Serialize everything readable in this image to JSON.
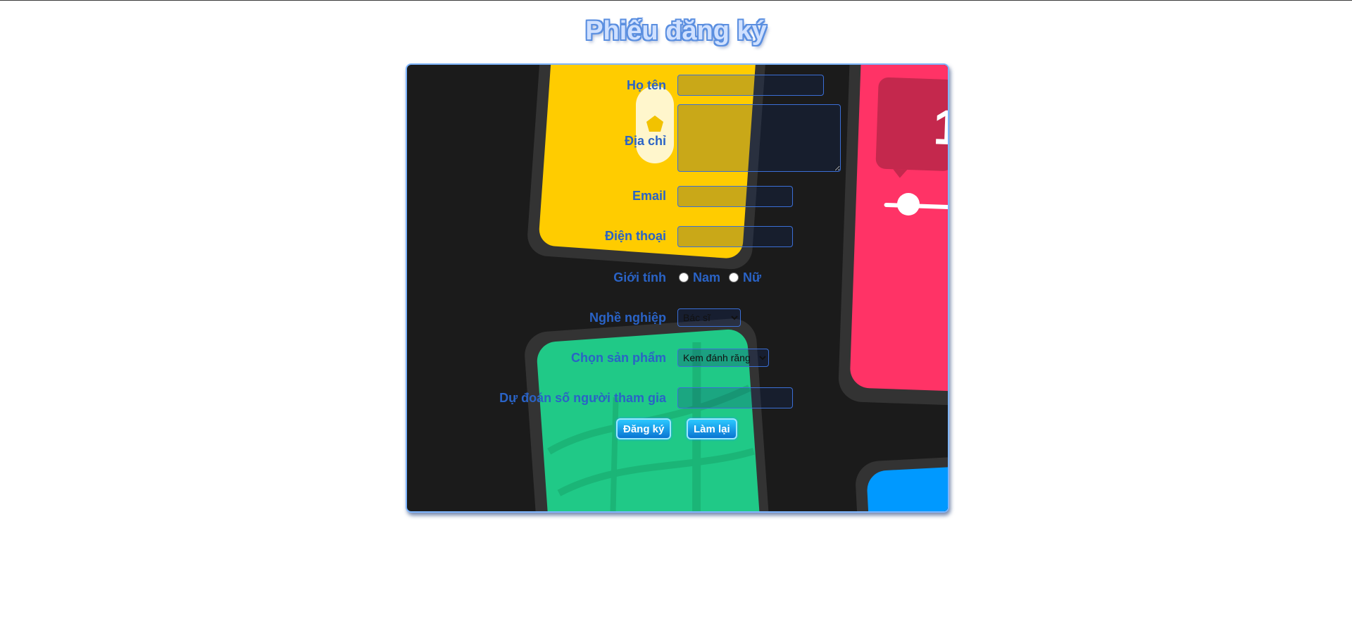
{
  "page": {
    "title": "Phiếu đăng ký"
  },
  "form": {
    "name_label": "Họ tên",
    "address_label": "Địa chỉ",
    "email_label": "Email",
    "phone_label": "Điện thoại",
    "gender_label": "Giới tính",
    "gender_options": [
      "Nam",
      "Nữ"
    ],
    "job_label": "Nghề nghiệp",
    "job_selected": "Bác sĩ",
    "product_label": "Chọn sản phẩm",
    "product_selected": "Kem đánh răng",
    "guess_label": "Dự đoán số người tham gia",
    "submit_label": "Đăng ký",
    "reset_label": "Làm lại",
    "name_value": "",
    "address_value": "",
    "email_value": "",
    "phone_value": "",
    "guess_value": ""
  },
  "colors": {
    "label": "#2a63c6",
    "panel_border": "#7fb6ff",
    "panel_bg": "#1b1b1b",
    "button_top": "#2bc8ff",
    "button_bottom": "#0a74d2"
  },
  "icons": [
    "location-pin-icon",
    "slider-knob-icon"
  ]
}
